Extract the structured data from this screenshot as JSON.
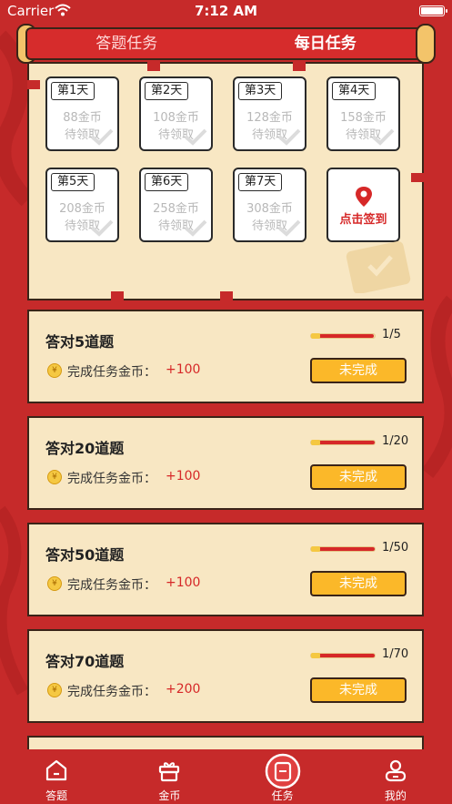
{
  "status_bar": {
    "carrier": "Carrier",
    "time": "7:12 AM"
  },
  "top_tabs": [
    {
      "label": "答题任务",
      "active": false
    },
    {
      "label": "每日任务",
      "active": true
    }
  ],
  "sign_in": {
    "days": [
      {
        "day": "第1天",
        "coins": "88金币",
        "state": "待领取"
      },
      {
        "day": "第2天",
        "coins": "108金币",
        "state": "待领取"
      },
      {
        "day": "第3天",
        "coins": "128金币",
        "state": "待领取"
      },
      {
        "day": "第4天",
        "coins": "158金币",
        "state": "待领取"
      },
      {
        "day": "第5天",
        "coins": "208金币",
        "state": "待领取"
      },
      {
        "day": "第6天",
        "coins": "258金币",
        "state": "待领取"
      },
      {
        "day": "第7天",
        "coins": "308金币",
        "state": "待领取"
      }
    ],
    "action_label": "点击签到"
  },
  "tasks": [
    {
      "title": "答对5道题",
      "reward_label": "完成任务金币：",
      "reward_value": "+100",
      "progress_text": "1/5",
      "progress": 0.2,
      "status": "未完成"
    },
    {
      "title": "答对20道题",
      "reward_label": "完成任务金币：",
      "reward_value": "+100",
      "progress_text": "1/20",
      "progress": 0.05,
      "status": "未完成"
    },
    {
      "title": "答对50道题",
      "reward_label": "完成任务金币：",
      "reward_value": "+100",
      "progress_text": "1/50",
      "progress": 0.02,
      "status": "未完成"
    },
    {
      "title": "答对70道题",
      "reward_label": "完成任务金币：",
      "reward_value": "+200",
      "progress_text": "1/70",
      "progress": 0.014,
      "status": "未完成"
    }
  ],
  "bottom_tabs": [
    {
      "label": "答题",
      "icon": "home-icon"
    },
    {
      "label": "金币",
      "icon": "gift-icon"
    },
    {
      "label": "任务",
      "icon": "task-icon",
      "active": true
    },
    {
      "label": "我的",
      "icon": "user-icon"
    }
  ],
  "colors": {
    "background": "#c62a2a",
    "panel": "#f8e7c3",
    "accent_red": "#d62828",
    "button_yellow": "#fbb829"
  }
}
